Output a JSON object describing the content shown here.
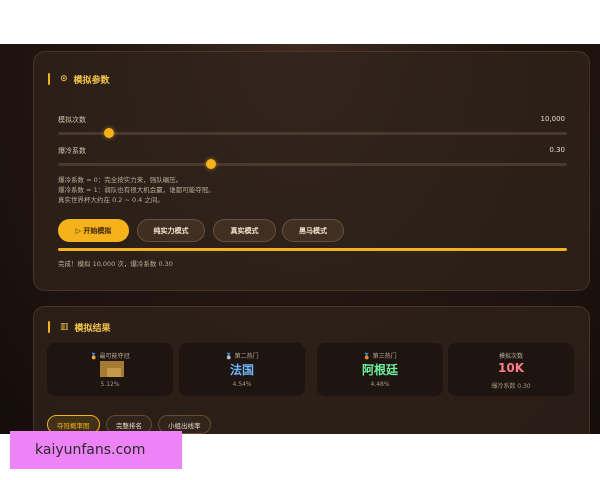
{
  "params": {
    "title": "模拟参数",
    "sims_label": "模拟次数",
    "sims_value": "10,000",
    "sims_fraction": 0.1,
    "upset_label": "爆冷系数",
    "upset_value": "0.30",
    "upset_fraction": 0.3,
    "desc_lines": [
      "爆冷系数 = 0：完全按实力来，强队碾压。",
      "爆冷系数 = 1：弱队也有很大机会赢，谁都可能夺冠。",
      "真实世界杯大约在 0.2 ~ 0.4 之间。"
    ],
    "buttons": {
      "start": "▷ 开始模拟",
      "pure": "纯实力模式",
      "real": "真实模式",
      "dark": "黑马模式"
    },
    "progress_fraction": 1.0,
    "status": "完成！模拟 10,000 次，爆冷系数 0.30"
  },
  "results": {
    "title": "模拟结果",
    "cards": [
      {
        "label": "🏅 最可能夺冠",
        "main": "",
        "sub": "5.12%",
        "color": "#f0c14a"
      },
      {
        "label": "🥈 第二热门",
        "main": "法国",
        "sub": "4.54%",
        "color": "#6fb4ff"
      },
      {
        "label": "🥉 第三热门",
        "main": "阿根廷",
        "sub": "4.48%",
        "color": "#6ff0a0"
      },
      {
        "label": "模拟次数",
        "main": "10K",
        "sub": "爆冷系数 0.30",
        "color": "#ff7b8a"
      }
    ],
    "tabs": [
      "夺冠概率图",
      "完整排名",
      "小组出线率"
    ]
  },
  "ad": {
    "text": "kaiyunfans.com"
  },
  "colors": {
    "accent": "#f5b21b",
    "accent_text": "#f0c14a"
  }
}
